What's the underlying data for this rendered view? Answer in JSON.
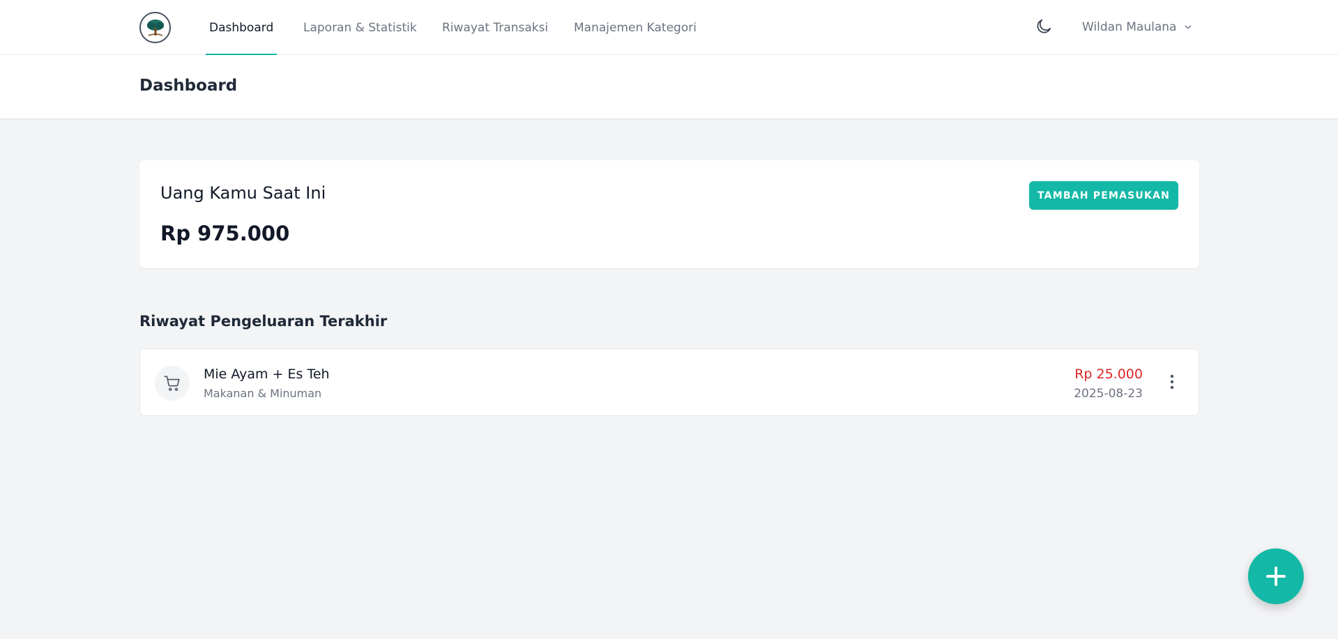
{
  "nav": {
    "items": [
      {
        "label": "Dashboard",
        "active": true
      },
      {
        "label": "Laporan & Statistik"
      },
      {
        "label": "Riwayat Transaksi"
      },
      {
        "label": "Manajemen Kategori"
      }
    ],
    "theme_icon": "moon-icon",
    "user_name": "Wildan Maulana"
  },
  "header": {
    "title": "Dashboard"
  },
  "balance": {
    "label": "Uang Kamu Saat Ini",
    "amount": "Rp 975.000",
    "add_button": "TAMBAH PEMASUKAN"
  },
  "history": {
    "title": "Riwayat Pengeluaran Terakhir",
    "items": [
      {
        "name": "Mie Ayam + Es Teh",
        "category": "Makanan & Minuman",
        "amount": "Rp 25.000",
        "date": "2025-08-23",
        "icon": "shopping-cart-icon"
      }
    ]
  },
  "colors": {
    "accent": "#14b8a6",
    "expense": "#dc2626",
    "background": "#f3f4f6"
  }
}
